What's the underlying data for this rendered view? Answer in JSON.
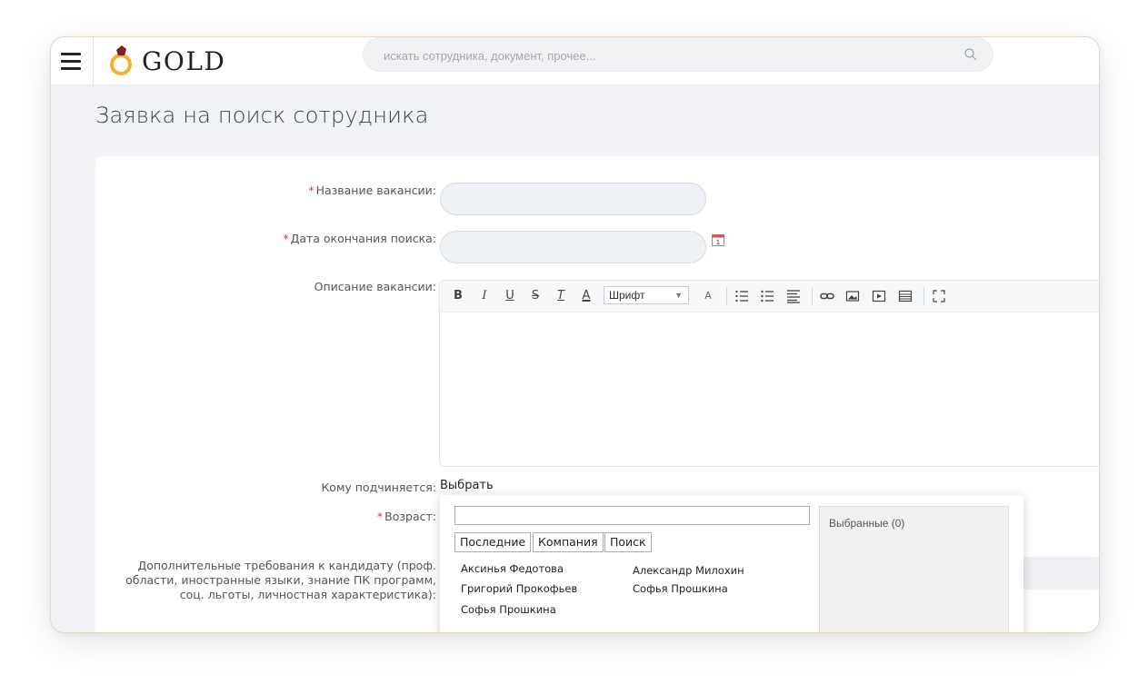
{
  "header": {
    "logo_text": "GOLD",
    "search_placeholder": "искать сотрудника, документ, прочее..."
  },
  "page": {
    "title": "Заявка на поиск сотрудника"
  },
  "form": {
    "required_mark": "*",
    "vacancy_name_label": "Название вакансии:",
    "end_date_label": "Дата окончания поиска:",
    "description_label": "Описание вакансии:",
    "reports_to_label": "Кому подчиняется:",
    "reports_to_link": "Выбрать",
    "age_label": "Возраст:",
    "extra_requirements_label": "Дополнительные требования к кандидату (проф. области, иностранные языки, знание ПК программ, соц. льготы, личностная характеристика):"
  },
  "editor": {
    "bold": "B",
    "italic": "I",
    "underline": "U",
    "strike": "S",
    "clear_format": "T",
    "text_color": "A",
    "font_select": "Шрифт",
    "font_size": "A"
  },
  "popup": {
    "tabs": [
      "Последние",
      "Компания",
      "Поиск"
    ],
    "people": [
      "Аксинья Федотова",
      "Александр Милохин",
      "Григорий Прокофьев",
      "Софья Прошкина",
      "Софья Прошкина"
    ],
    "selected_label": "Выбранные (0)"
  },
  "colors": {
    "required": "#e03a3a",
    "page_bg": "#f1f3f6",
    "logo_stone": "#7a1f2b",
    "logo_ring": "#f2b233"
  }
}
